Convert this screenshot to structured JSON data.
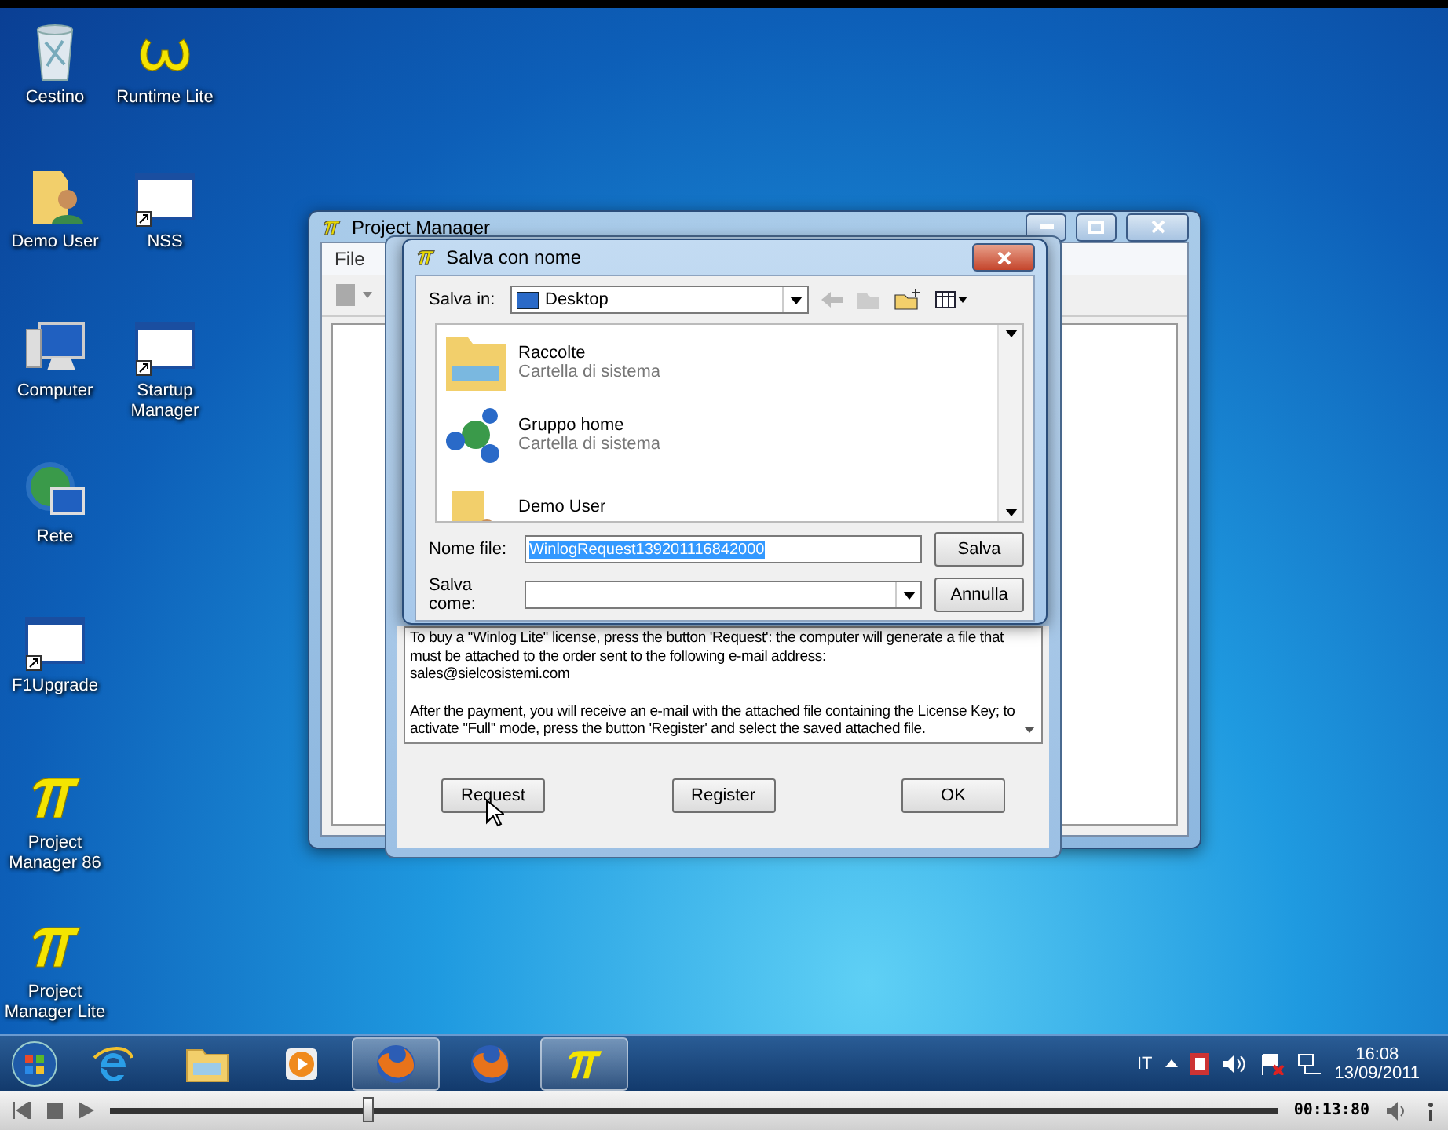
{
  "desktop_icons": [
    {
      "label": "Cestino",
      "kind": "recycle"
    },
    {
      "label": "Runtime Lite",
      "kind": "omega"
    },
    {
      "label": "Demo User",
      "kind": "user-folder"
    },
    {
      "label": "NSS",
      "kind": "window"
    },
    {
      "label": "Computer",
      "kind": "computer"
    },
    {
      "label": "Startup Manager",
      "kind": "window"
    },
    {
      "label": "Rete",
      "kind": "network"
    },
    {
      "label": "F1Upgrade",
      "kind": "window"
    },
    {
      "label": "Project Manager 86",
      "kind": "pi"
    },
    {
      "label": "Project Manager Lite",
      "kind": "pi"
    }
  ],
  "project_manager": {
    "title": "Project Manager",
    "menu": [
      "File"
    ]
  },
  "license_dialog": {
    "paragraphs": [
      "To buy a ''Winlog Lite'' license, press the button 'Request': the computer will generate a file that must be attached to the order sent to the following e-mail address:",
      "sales@sielcosistemi.com",
      "After the payment, you will receive an e-mail with the attached file containing the License Key; to activate ''Full'' mode, press the button 'Register' and select the saved attached file."
    ],
    "buttons": [
      "Request",
      "Register",
      "OK"
    ]
  },
  "save_dialog": {
    "title": "Salva con nome",
    "save_in_label": "Salva in:",
    "save_in_value": "Desktop",
    "items": [
      {
        "name": "Raccolte",
        "subtitle": "Cartella di sistema",
        "kind": "libraries"
      },
      {
        "name": "Gruppo home",
        "subtitle": "Cartella di sistema",
        "kind": "homegroup"
      },
      {
        "name": "Demo User",
        "kind": "user-folder"
      }
    ],
    "file_name_label": "Nome file:",
    "file_name": "WinlogRequest139201116842000",
    "save_as_label": "Salva come:",
    "buttons": [
      "Salva",
      "Annulla"
    ]
  },
  "taskbar": {
    "items": [
      {
        "kind": "ie",
        "selected": false
      },
      {
        "kind": "explorer",
        "selected": false
      },
      {
        "kind": "media",
        "selected": false
      },
      {
        "kind": "firefox",
        "selected": true
      },
      {
        "kind": "firefox",
        "selected": false
      },
      {
        "kind": "pi",
        "selected": true
      }
    ],
    "language": "IT",
    "time": "16:08",
    "date": "13/09/2011"
  },
  "player": {
    "time": "00:13:80",
    "level": 0.22
  }
}
